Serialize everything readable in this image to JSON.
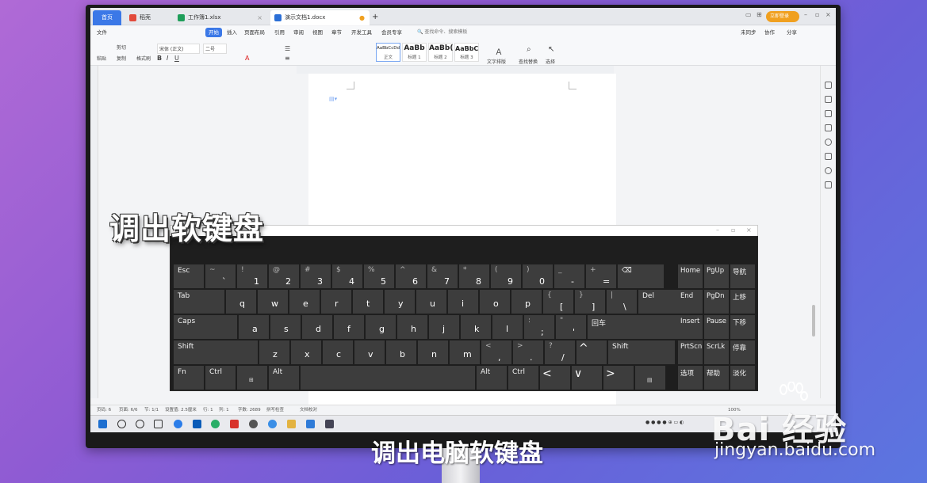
{
  "overlay": {
    "caption": "调出软键盘",
    "subtitle": "调出电脑软键盘",
    "watermark_brand": "Bai 经验",
    "watermark_url": "jingyan.baidu.com"
  },
  "wps": {
    "tabs": [
      {
        "label": "首页"
      },
      {
        "label": "稻壳"
      },
      {
        "label": "工作簿1.xlsx"
      },
      {
        "label": "演示文档1.docx"
      }
    ],
    "login_label": "立即登录",
    "menu": [
      "文件",
      "开始",
      "插入",
      "页面布局",
      "引用",
      "审阅",
      "视图",
      "章节",
      "开发工具",
      "会员专享"
    ],
    "search_label": "查找命令、搜索模板",
    "right_actions": [
      "未同步",
      "协作",
      "分享"
    ],
    "ribbon": {
      "paste": "粘贴",
      "cut": "剪切",
      "copy": "复制",
      "format_painter": "格式刷",
      "font_name": "宋体 (正文)",
      "font_size": "二号",
      "styles": [
        {
          "preview": "AaBbCcDd",
          "name": "正文"
        },
        {
          "preview": "AaBb",
          "name": "标题 1"
        },
        {
          "preview": "AaBb(",
          "name": "标题 2"
        },
        {
          "preview": "AaBbC",
          "name": "标题 3"
        }
      ],
      "text_layout": "文字排版",
      "find_replace": "查找替换",
      "select": "选择"
    },
    "status": {
      "page": "页码: 6",
      "pages": "页面: 6/6",
      "section": "节: 1/1",
      "setting": "设置值: 2.5厘米",
      "row": "行: 1",
      "col": "列: 1",
      "words": "字数: 2689",
      "spell": "拼写检查",
      "proof": "文档校对",
      "zoom": "100%"
    }
  },
  "keyboard": {
    "rows": [
      [
        {
          "main": "Esc"
        },
        {
          "top": "~",
          "base": "`"
        },
        {
          "top": "!",
          "base": "1"
        },
        {
          "top": "@",
          "base": "2"
        },
        {
          "top": "#",
          "base": "3"
        },
        {
          "top": "$",
          "base": "4"
        },
        {
          "top": "%",
          "base": "5"
        },
        {
          "top": "^",
          "base": "6"
        },
        {
          "top": "&",
          "base": "7"
        },
        {
          "top": "*",
          "base": "8"
        },
        {
          "top": "(",
          "base": "9"
        },
        {
          "top": ")",
          "base": "0"
        },
        {
          "top": "_",
          "base": "-"
        },
        {
          "top": "+",
          "base": "="
        },
        {
          "main": "⌫"
        }
      ],
      [
        {
          "main": "Tab"
        },
        {
          "main": "q"
        },
        {
          "main": "w"
        },
        {
          "main": "e"
        },
        {
          "main": "r"
        },
        {
          "main": "t"
        },
        {
          "main": "y"
        },
        {
          "main": "u"
        },
        {
          "main": "i"
        },
        {
          "main": "o"
        },
        {
          "main": "p"
        },
        {
          "top": "{",
          "base": "["
        },
        {
          "top": "}",
          "base": "]"
        },
        {
          "top": "|",
          "base": "\\"
        },
        {
          "main": "Del"
        }
      ],
      [
        {
          "main": "Caps"
        },
        {
          "main": "a"
        },
        {
          "main": "s"
        },
        {
          "main": "d"
        },
        {
          "main": "f"
        },
        {
          "main": "g"
        },
        {
          "main": "h"
        },
        {
          "main": "j"
        },
        {
          "main": "k"
        },
        {
          "main": "l"
        },
        {
          "top": ":",
          "base": ";"
        },
        {
          "top": "\"",
          "base": "'"
        },
        {
          "main": "回车"
        }
      ],
      [
        {
          "main": "Shift"
        },
        {
          "main": "z"
        },
        {
          "main": "x"
        },
        {
          "main": "c"
        },
        {
          "main": "v"
        },
        {
          "main": "b"
        },
        {
          "main": "n"
        },
        {
          "main": "m"
        },
        {
          "top": "<",
          "base": ","
        },
        {
          "top": ">",
          "base": "."
        },
        {
          "top": "?",
          "base": "/"
        },
        {
          "main": "^"
        },
        {
          "main": "Shift"
        }
      ],
      [
        {
          "main": "Fn"
        },
        {
          "main": "Ctrl"
        },
        {
          "main": "⊞"
        },
        {
          "main": "Alt"
        },
        {
          "main": ""
        },
        {
          "main": "Alt"
        },
        {
          "main": "Ctrl"
        },
        {
          "main": "<"
        },
        {
          "main": "∨"
        },
        {
          "main": ">"
        },
        {
          "main": "▤"
        }
      ]
    ],
    "nav_keys": [
      [
        "Home",
        "PgUp",
        "导航"
      ],
      [
        "End",
        "PgDn",
        "上移"
      ],
      [
        "Insert",
        "Pause",
        "下移"
      ],
      [
        "PrtScn",
        "ScrLk",
        "停靠"
      ],
      [
        "选项",
        "帮助",
        "淡化"
      ]
    ]
  },
  "colors": {
    "accent": "#3b78e7",
    "key_bg": "#3d3d3d",
    "keyboard_bg": "#1e1e1e",
    "login_orange": "#f0a020"
  }
}
